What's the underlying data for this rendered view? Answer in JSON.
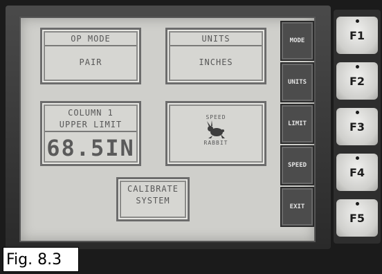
{
  "screen": {
    "op_mode": {
      "label": "OP MODE",
      "value": "PAIR"
    },
    "units": {
      "label": "UNITS",
      "value": "INCHES"
    },
    "column": {
      "line1": "COLUMN 1",
      "line2": "UPPER LIMIT",
      "value": "68.5IN"
    },
    "speed": {
      "top": "SPEED",
      "bottom": "RABBIT",
      "icon": "rabbit-icon"
    },
    "calibrate": {
      "line1": "CALIBRATE",
      "line2": "SYSTEM"
    }
  },
  "softkeys": [
    "MODE",
    "UNITS",
    "LIMIT",
    "SPEED",
    "EXIT"
  ],
  "function_keys": [
    "F1",
    "F2",
    "F3",
    "F4",
    "F5"
  ],
  "caption": "Fig. 8.3"
}
